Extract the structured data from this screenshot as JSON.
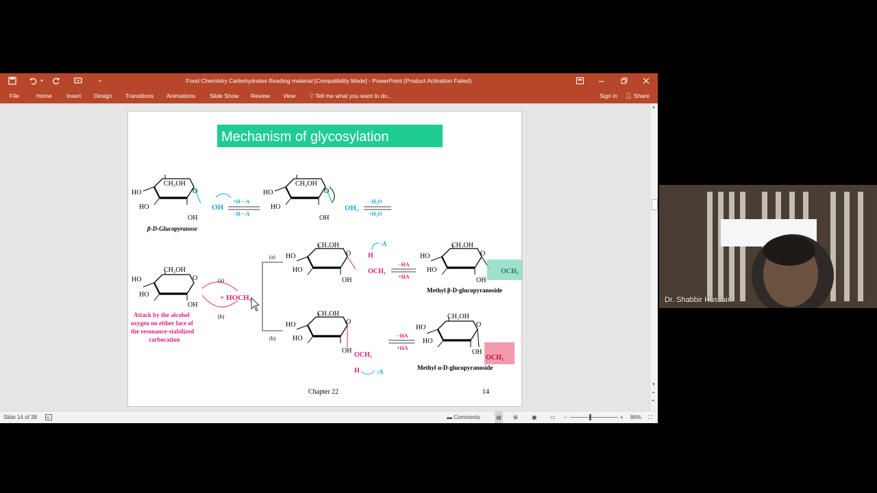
{
  "window": {
    "title": "Food Chemistry Carbohydrates  Reading material [Compatibility Mode] - PowerPoint (Product Activation Failed)"
  },
  "ribbon": {
    "tabs": [
      "File",
      "Home",
      "Insert",
      "Design",
      "Transitions",
      "Animations",
      "Slide Show",
      "Review",
      "View"
    ],
    "tell_me": "Tell me what you want to do...",
    "sign_in": "Sign in",
    "share": "Share"
  },
  "slide": {
    "title": "Mechanism of glycosylation",
    "footer_left": "Chapter 22",
    "footer_right": "14",
    "labels": {
      "ch2oh": "CH₂OH",
      "ho": "HO",
      "oh": "OH",
      "o": "O",
      "oh_blue": "OH",
      "oh2": "OH₂",
      "plus_ha": "+H—A",
      "minus_ha_blue": "−H—A",
      "minus_h2o": "−H₂O",
      "plus_h2o": "+H₂O",
      "beta_glucopyranose": "β-D-Glucopyranose",
      "a": "(a)",
      "b": "(b)",
      "hoch3": "+ HOCH₃",
      "attack_text": [
        "Attack by the alcohol",
        "oxygen on either face of",
        "the resonance-stabilized",
        "carbocation"
      ],
      "h": "H",
      "colon_a": ":A",
      "och3": "OCH₃",
      "minus_ha": "−HA",
      "plus_ha2": "+HA",
      "methyl_beta": "Methyl β-D-glucopyranoside",
      "methyl_alpha": "Methyl α-D-glucopyranoside"
    },
    "colors": {
      "title_bg": "#1fcc94",
      "blue": "#1aa3d9",
      "magenta": "#d6217a",
      "teal_box": "#8fdcc4",
      "pink_box": "#f08aa0"
    }
  },
  "status": {
    "slide_indicator": "Slide 14 of 38",
    "comments": "Comments",
    "zoom": "86%"
  },
  "video": {
    "participant": "Dr. Shabbir Hussain"
  }
}
